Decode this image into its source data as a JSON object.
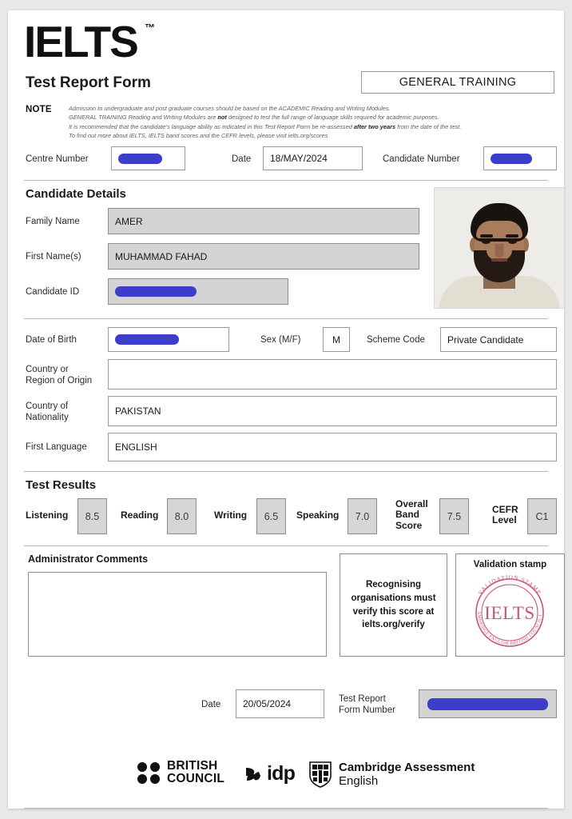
{
  "document": {
    "brand": "IELTS",
    "trademark": "™",
    "title": "Test Report Form",
    "module": "GENERAL TRAINING"
  },
  "note": {
    "label": "NOTE",
    "line1": "Admission to undergraduate and post graduate courses should be based on the ACADEMIC Reading and Writing Modules.",
    "line2_a": "GENERAL TRAINING Reading and Writing Modules are ",
    "line2_b": "not",
    "line2_c": " designed to test the full range of language skills required for academic purposes.",
    "line3_a": "It is recommended that the candidate's language ability as indicated in this Test Report Form be re-assessed ",
    "line3_b": "after two years",
    "line3_c": " from the date of the test.",
    "line4": "To find out more about IELTS, IELTS band scores and the CEFR levels, please visit ielts.org/scores"
  },
  "header_fields": {
    "centre_number_label": "Centre Number",
    "centre_number_value": "",
    "date_label": "Date",
    "date_value": "18/MAY/2024",
    "candidate_number_label": "Candidate Number",
    "candidate_number_value": ""
  },
  "candidate_details": {
    "heading": "Candidate Details",
    "family_name_label": "Family Name",
    "family_name_value": "AMER",
    "first_names_label": "First Name(s)",
    "first_names_value": "MUHAMMAD FAHAD",
    "candidate_id_label": "Candidate ID",
    "candidate_id_value": "",
    "date_of_birth_label": "Date of Birth",
    "date_of_birth_value": "",
    "sex_label": "Sex (M/F)",
    "sex_value": "M",
    "scheme_code_label": "Scheme Code",
    "scheme_code_value": "Private Candidate",
    "country_origin_label_line1": "Country or",
    "country_origin_label_line2": "Region of Origin",
    "country_origin_value": "",
    "country_nationality_label_line1": "Country of",
    "country_nationality_label_line2": "Nationality",
    "country_nationality_value": "PAKISTAN",
    "first_language_label": "First Language",
    "first_language_value": "ENGLISH"
  },
  "test_results": {
    "heading": "Test Results",
    "scores": [
      {
        "label": "Listening",
        "value": "8.5"
      },
      {
        "label": "Reading",
        "value": "8.0"
      },
      {
        "label": "Writing",
        "value": "6.5"
      },
      {
        "label": "Speaking",
        "value": "7.0"
      }
    ],
    "overall_label_line1": "Overall",
    "overall_label_line2": "Band",
    "overall_label_line3": "Score",
    "overall_value": "7.5",
    "cefr_label_line1": "CEFR",
    "cefr_label_line2": "Level",
    "cefr_value": "C1"
  },
  "administrator": {
    "comments_label": "Administrator Comments",
    "comments_value": "",
    "verify_text_line1": "Recognising",
    "verify_text_line2": "organisations must",
    "verify_text_line3": "verify this score at",
    "verify_text_line4": "ielts.org/verify"
  },
  "validation_stamp": {
    "title": "Validation stamp",
    "center_text": "IELTS",
    "top_arc_text": "VALIDATION STAMP",
    "bottom_arc_text": "CAMBRIDGE ENGLISH  BRITISH COUNCIL  IDP",
    "color": "#c9566e"
  },
  "footer_fields": {
    "date_label": "Date",
    "date_value": "20/05/2024",
    "form_number_label_line1": "Test Report",
    "form_number_label_line2": "Form Number",
    "form_number_value": ""
  },
  "partners": {
    "british_council_line1": "BRITISH",
    "british_council_line2": "COUNCIL",
    "idp": "idp",
    "cambridge_line1": "Cambridge Assessment",
    "cambridge_line2": "English"
  },
  "colors": {
    "redaction": "#3d3dcc",
    "field_gray": "#d4d4d4",
    "score_gray": "#d6d6d6",
    "stamp_pink": "#c9566e"
  }
}
